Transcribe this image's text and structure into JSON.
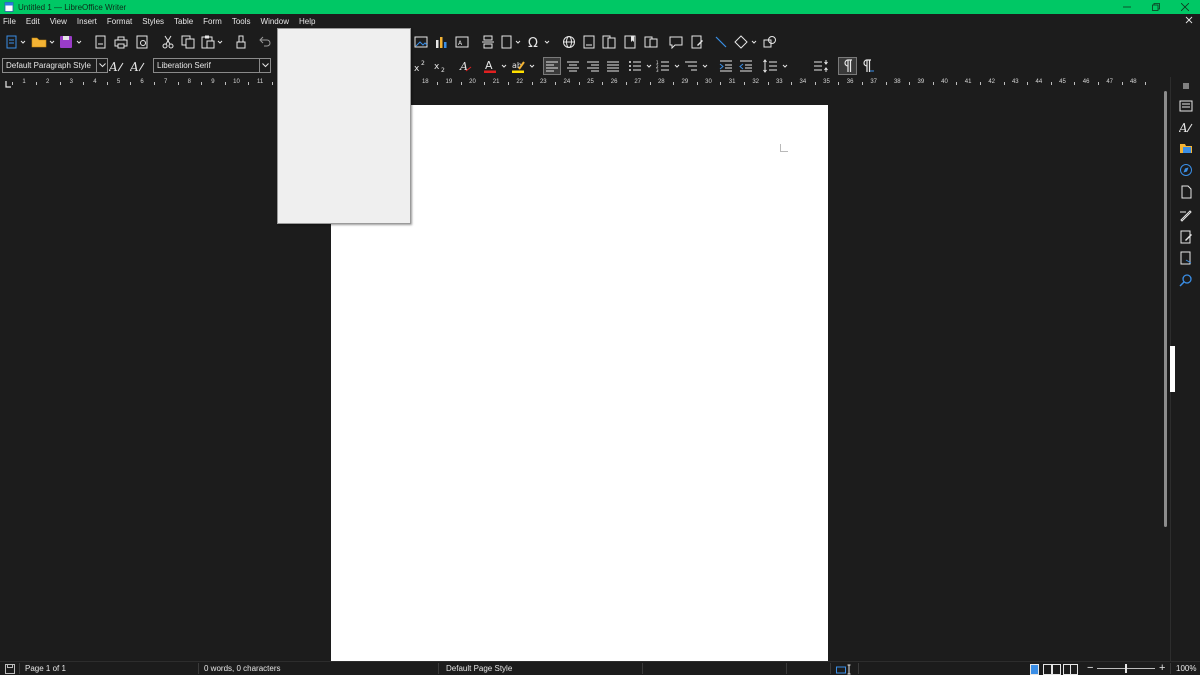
{
  "window": {
    "title": "Untitled 1 — LibreOffice Writer",
    "accent_color": "#00c865",
    "minimize_icon": "minimize-icon",
    "maximize_icon": "restore-icon",
    "close_icon": "close-icon"
  },
  "menubar": {
    "items": [
      "File",
      "Edit",
      "View",
      "Insert",
      "Format",
      "Styles",
      "Table",
      "Form",
      "Tools",
      "Window",
      "Help"
    ]
  },
  "formatting": {
    "paragraph_style": "Default Paragraph Style",
    "font_name": "Liberation Serif"
  },
  "ruler": {
    "labels": [
      "1",
      "2",
      "3",
      "4",
      "5",
      "6",
      "7",
      "8",
      "9",
      "10",
      "11",
      "18",
      "19",
      "20",
      "21",
      "22",
      "23",
      "24",
      "25",
      "26",
      "27",
      "28",
      "29",
      "30",
      "31",
      "32",
      "33",
      "34",
      "35",
      "36",
      "37",
      "38",
      "39",
      "40",
      "41",
      "42",
      "43",
      "44",
      "45",
      "46",
      "47",
      "48"
    ]
  },
  "statusbar": {
    "page_info": "Page 1 of 1",
    "word_count": "0 words, 0 characters",
    "page_style": "Default Page Style",
    "zoom": "100%",
    "zoom_minus": "−",
    "zoom_plus": "+"
  },
  "colors": {
    "background": "#1c1c1c",
    "page": "#ffffff",
    "font_color_red": "#e02020",
    "highlight_yellow": "#ffe000",
    "icon_blue": "#3a8ee6"
  }
}
